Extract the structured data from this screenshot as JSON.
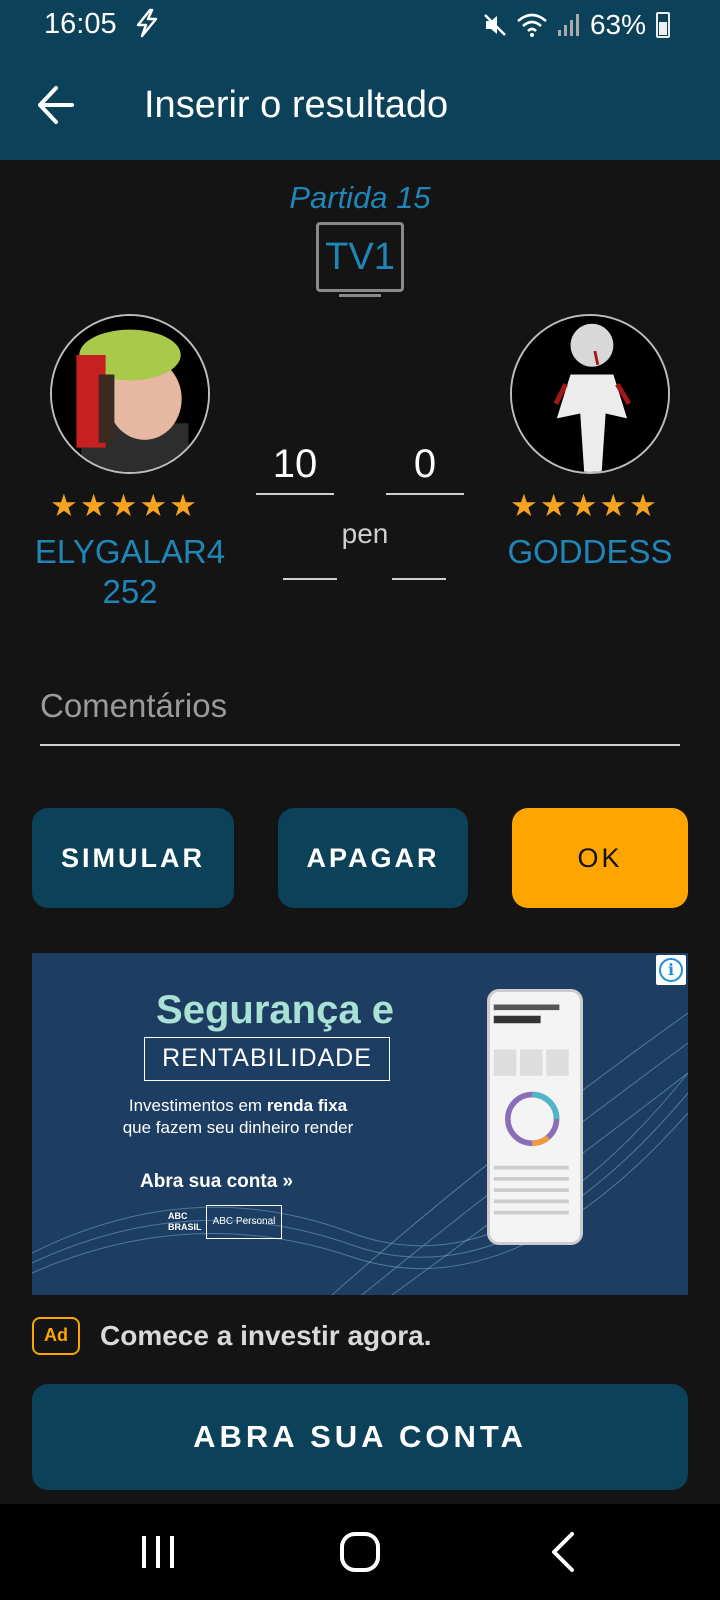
{
  "status_bar": {
    "time": "16:05",
    "battery": "63%",
    "icons": [
      "flash-icon",
      "mute-icon",
      "wifi-icon",
      "signal-icon",
      "battery-icon"
    ]
  },
  "app_bar": {
    "title": "Inserir o resultado",
    "back_icon": "arrow-left-icon"
  },
  "match": {
    "label": "Partida 15",
    "table": "TV1"
  },
  "player_left": {
    "name": "ELYGALAR4\n252",
    "stars": "★★★★★"
  },
  "player_right": {
    "name": "GODDESS",
    "stars": "★★★★★"
  },
  "score": {
    "left": "10",
    "right": "0",
    "pen_label": "pen",
    "pen_left": "",
    "pen_right": ""
  },
  "comments": {
    "placeholder": "Comentários",
    "value": ""
  },
  "buttons": {
    "simulate": "SIMULAR",
    "delete": "APAGAR",
    "ok": "OK"
  },
  "ad": {
    "headline": "Segurança e",
    "subhead": "RENTABILIDADE",
    "body_line1": "Investimentos em ",
    "body_bold": "renda fixa",
    "body_line2": "que fazem seu dinheiro render",
    "cta": "Abra sua conta",
    "logo_left": "ABC BRASIL",
    "logo_right": "ABC Personal",
    "badge": "Ad",
    "tagline": "Comece a investir agora.",
    "action_button": "ABRA SUA CONTA",
    "colors": {
      "accent": "#fea500",
      "primary": "#0b4159",
      "link": "#1f86b7"
    }
  },
  "nav_bar": {
    "icons": [
      "recents-icon",
      "home-icon",
      "back-icon"
    ]
  }
}
